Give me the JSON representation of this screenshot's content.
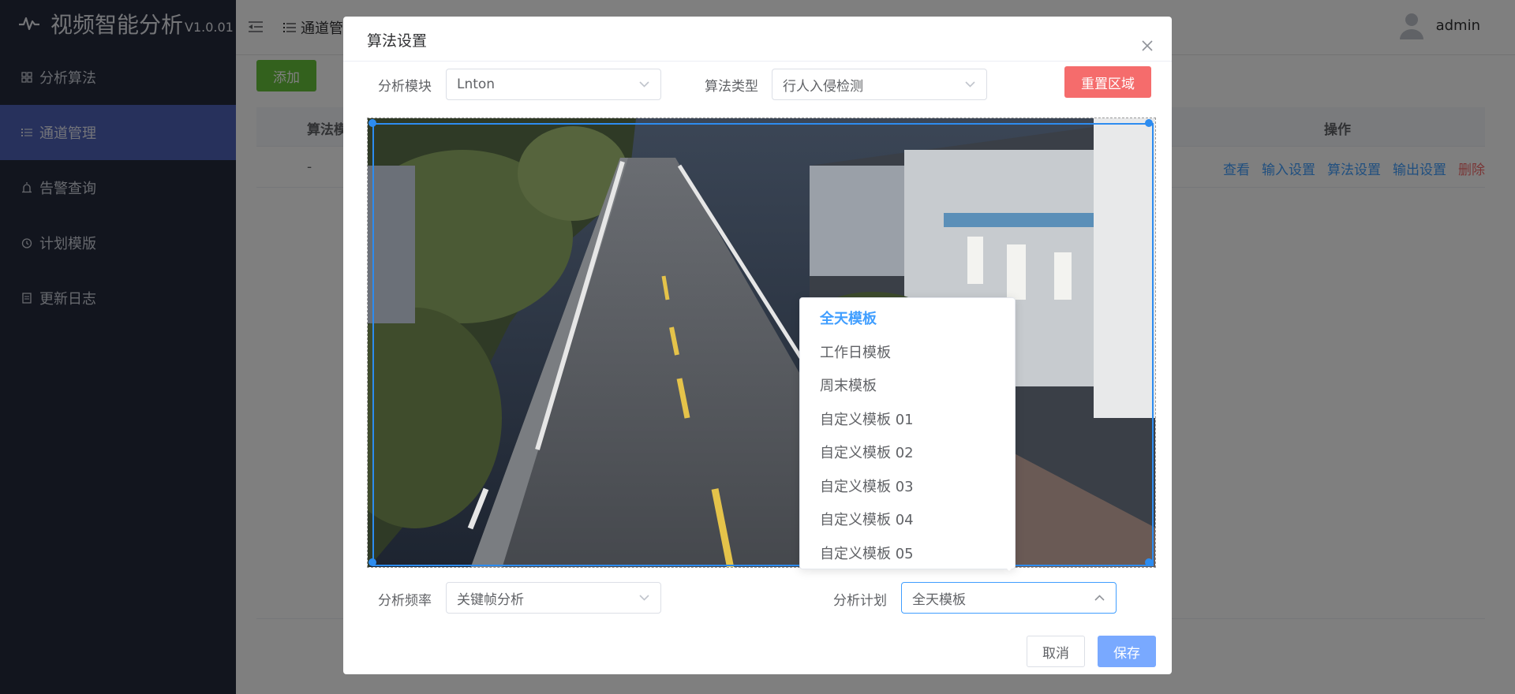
{
  "app": {
    "title": "视频智能分析",
    "version": "V1.0.01"
  },
  "sidebar": {
    "items": [
      {
        "label": "分析算法",
        "icon": "grid-icon"
      },
      {
        "label": "通道管理",
        "icon": "list-icon",
        "active": true
      },
      {
        "label": "告警查询",
        "icon": "alarm-icon"
      },
      {
        "label": "计划模版",
        "icon": "clock-icon"
      },
      {
        "label": "更新日志",
        "icon": "document-icon"
      }
    ]
  },
  "header": {
    "breadcrumb": "通道管",
    "user": "admin"
  },
  "main": {
    "add_label": "添加",
    "columns": {
      "algo": "算法模",
      "ops": "操作"
    },
    "row": {
      "algo": "-",
      "ops": [
        "查看",
        "输入设置",
        "算法设置",
        "输出设置",
        "删除"
      ]
    }
  },
  "dialog": {
    "title": "算法设置",
    "module_label": "分析模块",
    "module_value": "Lnton",
    "algo_type_label": "算法类型",
    "algo_type_value": "行人入侵检测",
    "reset_label": "重置区域",
    "freq_label": "分析频率",
    "freq_value": "关键帧分析",
    "plan_label": "分析计划",
    "plan_value": "全天模板",
    "plan_options": [
      "全天模板",
      "工作日模板",
      "周末模板",
      "自定义模板 01",
      "自定义模板 02",
      "自定义模板 03",
      "自定义模板 04",
      "自定义模板 05"
    ],
    "cancel_label": "取消",
    "save_label": "保存"
  },
  "colors": {
    "sidebar_bg": "#252a3d",
    "active_item": "#4f63b8",
    "primary": "#409eff",
    "success": "#67c23a",
    "danger": "#f56c6c",
    "roi": "#2d8cf0"
  }
}
